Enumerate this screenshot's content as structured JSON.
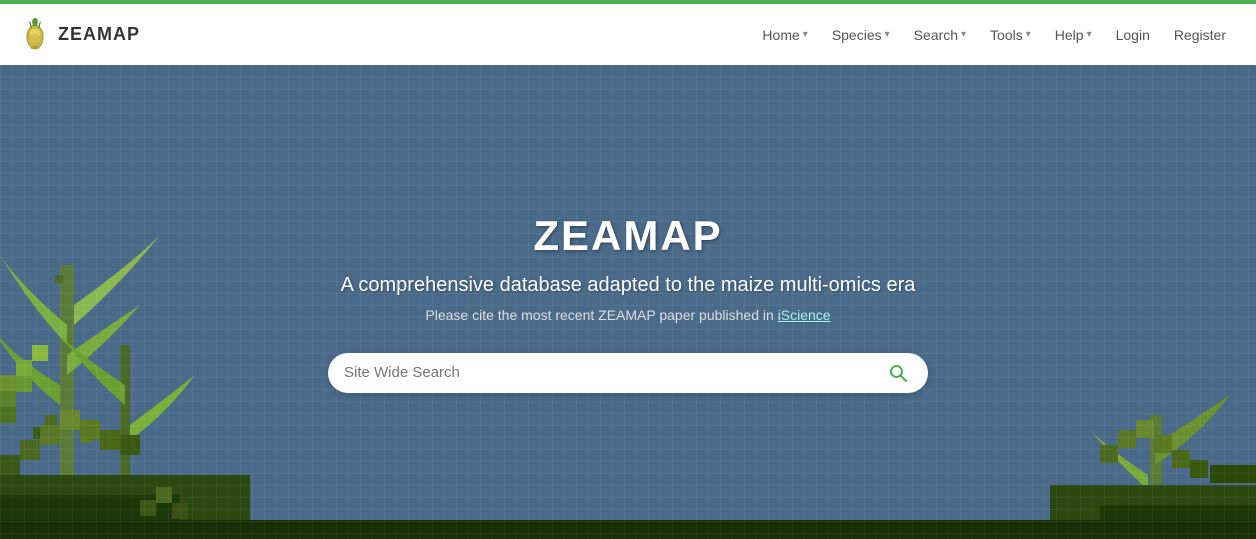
{
  "brand": {
    "name": "ZEAMAP",
    "logo_alt": "ZEAMAP corn logo"
  },
  "nav": {
    "items": [
      {
        "label": "Home",
        "has_dropdown": true
      },
      {
        "label": "Species",
        "has_dropdown": true
      },
      {
        "label": "Search",
        "has_dropdown": true
      },
      {
        "label": "Tools",
        "has_dropdown": true
      },
      {
        "label": "Help",
        "has_dropdown": true
      }
    ],
    "auth": {
      "login": "Login",
      "register": "Register"
    }
  },
  "hero": {
    "title": "ZEAMAP",
    "subtitle": "A comprehensive database adapted to the maize multi-omics era",
    "cite_prefix": "Please cite the most recent ZEAMAP paper published in",
    "cite_link_text": "iScience",
    "cite_link_url": "#"
  },
  "search": {
    "placeholder": "Site Wide Search",
    "button_label": "Search"
  },
  "colors": {
    "navbar_border": "#4caf50",
    "hero_bg": "#4a6a8a",
    "search_icon": "#4caf50"
  }
}
